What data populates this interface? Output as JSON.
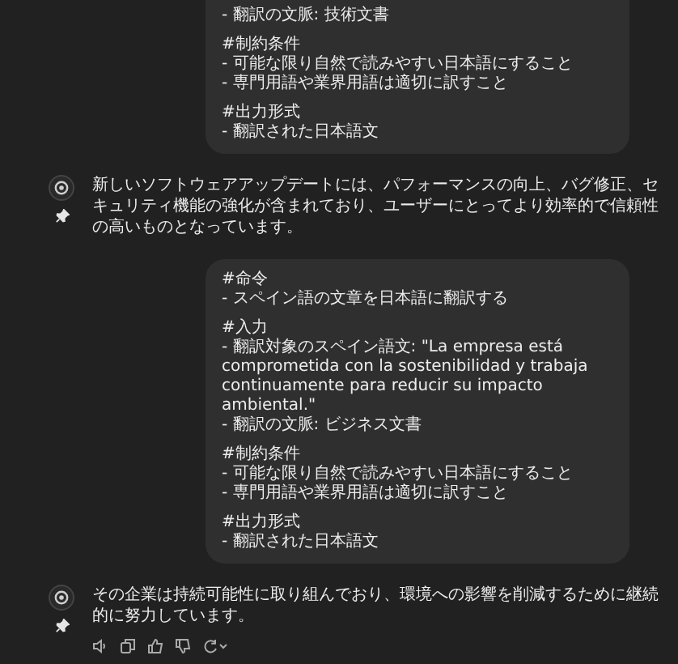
{
  "messages": [
    {
      "kind": "user",
      "cut_top": true,
      "sections": [
        {
          "lines": [
            "- 翻訳の文脈: 技術文書"
          ]
        },
        {
          "heading": "#制約条件",
          "lines": [
            "- 可能な限り自然で読みやすい日本語にすること",
            "- 専門用語や業界用語は適切に訳すこと"
          ]
        },
        {
          "heading": "#出力形式",
          "lines": [
            "- 翻訳された日本語文"
          ]
        }
      ]
    },
    {
      "kind": "assistant",
      "text": "新しいソフトウェアアップデートには、パフォーマンスの向上、バグ修正、セキュリティ機能の強化が含まれており、ユーザーにとってより効率的で信頼性の高いものとなっています。",
      "actions": false
    },
    {
      "kind": "user",
      "cut_top": false,
      "sections": [
        {
          "heading": "#命令",
          "lines": [
            "- スペイン語の文章を日本語に翻訳する"
          ]
        },
        {
          "heading": "#入力",
          "lines": [
            "- 翻訳対象のスペイン語文: \"La empresa está comprometida con la sostenibilidad y trabaja continuamente para reducir su impacto ambiental.\"",
            "- 翻訳の文脈: ビジネス文書"
          ]
        },
        {
          "heading": "#制約条件",
          "lines": [
            "- 可能な限り自然で読みやすい日本語にすること",
            "- 専門用語や業界用語は適切に訳すこと"
          ]
        },
        {
          "heading": "#出力形式",
          "lines": [
            "- 翻訳された日本語文"
          ]
        }
      ]
    },
    {
      "kind": "assistant",
      "text": "その企業は持続可能性に取り組んでおり、環境への影響を削減するために継続的に努力しています。",
      "actions": true
    }
  ]
}
